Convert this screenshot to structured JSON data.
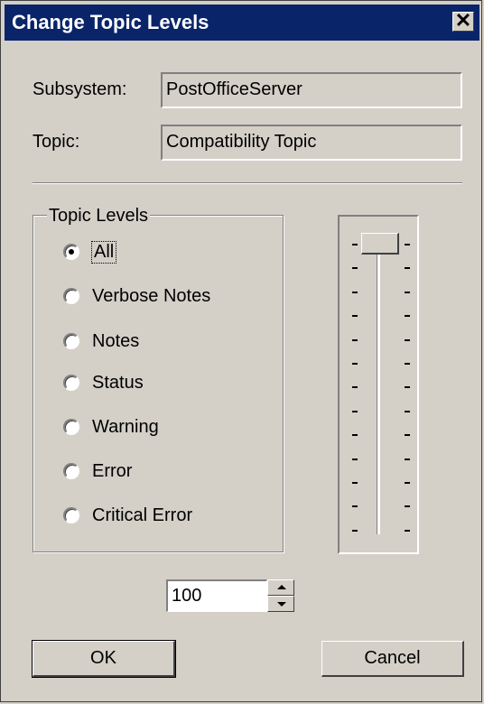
{
  "window": {
    "title": "Change Topic Levels",
    "close_glyph": "✕"
  },
  "fields": {
    "subsystem": {
      "label": "Subsystem:",
      "value": "PostOfficeServer"
    },
    "topic": {
      "label": "Topic:",
      "value": "Compatibility Topic"
    }
  },
  "topic_levels": {
    "legend": "Topic Levels",
    "selected": "All",
    "options": [
      "All",
      "Verbose Notes",
      "Notes",
      "Status",
      "Warning",
      "Error",
      "Critical Error"
    ]
  },
  "level_value": "100",
  "buttons": {
    "ok": "OK",
    "cancel": "Cancel"
  },
  "colors": {
    "title_bar": "#0a246a",
    "face": "#d4d0c8"
  }
}
